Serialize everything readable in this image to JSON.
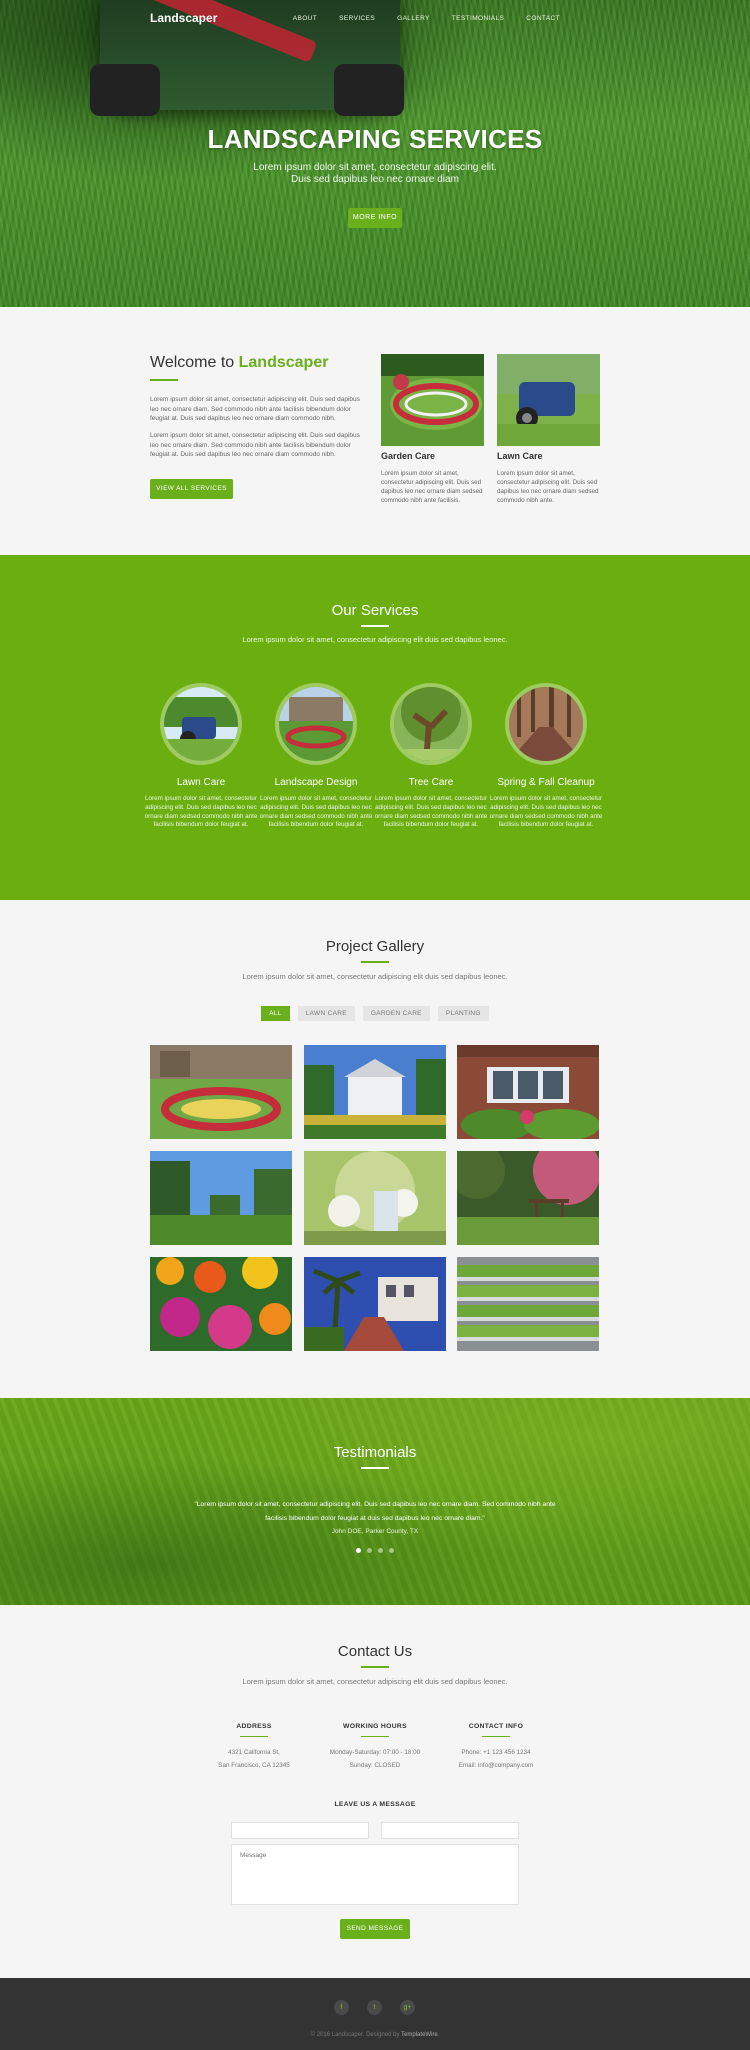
{
  "nav": {
    "logo": "Landscaper",
    "items": [
      "ABOUT",
      "SERVICES",
      "GALLERY",
      "TESTIMONIALS",
      "CONTACT"
    ]
  },
  "hero": {
    "title": "LANDSCAPING SERVICES",
    "subtitle_line1": "Lorem ipsum dolor sit amet, consectetur adipiscing elit.",
    "subtitle_line2": "Duis sed dapibus leo nec ornare diam",
    "button": "MORE INFO"
  },
  "welcome": {
    "title_prefix": "Welcome to ",
    "title_accent": "Landscaper",
    "para1": "Lorem ipsum dolor sit amet, consectetur adipiscing elit. Duis sed dapibus leo nec ornare diam. Sed commodo nibh ante facilisis bibendum dolor feugiat at. Duis sed dapibus leo nec ornare diam commodo nibh.",
    "para2": "Lorem ipsum dolor sit amet, consectetur adipiscing elit. Duis sed dapibus leo nec ornare diam. Sed commodo nibh ante facilisis bibendum dolor feugiat at. Duis sed dapibus leo nec ornare diam commodo nibh.",
    "button": "VIEW ALL SERVICES",
    "cards": [
      {
        "title": "Garden Care",
        "text": "Lorem ipsum dolor sit amet, consectetur adipiscing elit. Duis sed dapibus leo nec ornare diam sedsed commodo nibh ante facilisis."
      },
      {
        "title": "Lawn Care",
        "text": "Lorem ipsum dolor sit amet, consectetur adipiscing elit. Duis sed dapibus leo nec ornare diam sedsed commodo nibh ante."
      }
    ]
  },
  "services": {
    "title": "Our Services",
    "subtitle": "Lorem ipsum dolor sit amet, consectetur adipiscing elit duis sed dapibus leonec.",
    "items": [
      {
        "title": "Lawn Care",
        "text": "Lorem ipsum dolor sit amet, consectetur adipiscing elit. Duis sed dapibus leo nec ornare diam sedsed commodo nibh ante facilisis bibendum dolor feugiat at."
      },
      {
        "title": "Landscape Design",
        "text": "Lorem ipsum dolor sit amet, consectetur adipiscing elit. Duis sed dapibus leo nec ornare diam sedsed commodo nibh ante facilisis bibendum dolor feugiat at."
      },
      {
        "title": "Tree Care",
        "text": "Lorem ipsum dolor sit amet, consectetur adipiscing elit. Duis sed dapibus leo nec ornare diam sedsed commodo nibh ante facilisis bibendum dolor feugiat at."
      },
      {
        "title": "Spring & Fall Cleanup",
        "text": "Lorem ipsum dolor sit amet, consectetur adipiscing elit. Duis sed dapibus leo nec ornare diam sedsed commodo nibh ante facilisis bibendum dolor feugiat at."
      }
    ]
  },
  "gallery": {
    "title": "Project Gallery",
    "subtitle": "Lorem ipsum dolor sit amet, consectetur adipiscing elit duis sed dapibus leonec.",
    "filters": [
      "ALL",
      "LAWN CARE",
      "GARDEN CARE",
      "PLANTING"
    ],
    "active_filter": "ALL"
  },
  "testimonials": {
    "title": "Testimonials",
    "quote_line1": "\"Lorem ipsum dolor sit amet, consectetur adipiscing elit. Duis sed dapibus leo nec ornare diam. Sed commodo nibh ante",
    "quote_line2": "facilisis bibendum dolor feugiat at duis sed dapibus leo nec ornare diam.\"",
    "author": "John DOE, Parker County, TX",
    "slides": 4,
    "active_slide": 1
  },
  "contact": {
    "title": "Contact Us",
    "subtitle": "Lorem ipsum dolor sit amet, consectetur adipiscing elit duis sed dapibus leonec.",
    "address": {
      "heading": "ADDRESS",
      "line1": "4321 California St,",
      "line2": "San Francisco, CA 12345"
    },
    "hours": {
      "heading": "WORKING HOURS",
      "line1": "Monday-Saturday: 07:00 - 18:00",
      "line2": "Sunday: CLOSED"
    },
    "info": {
      "heading": "CONTACT INFO",
      "line1": "Phone: +1 123 456 1234",
      "line2": "Email: info@company.com"
    },
    "form_title": "LEAVE US A MESSAGE",
    "message_placeholder": "Message",
    "button": "SEND MESSAGE"
  },
  "footer": {
    "social_icons": [
      "f",
      "t",
      "g+"
    ],
    "copyright": "© 2016 Landscaper. Designed by ",
    "designer": "TemplateWire",
    "copyright_end": "."
  },
  "colors": {
    "accent": "#6aaf1c",
    "footer": "#333333"
  }
}
